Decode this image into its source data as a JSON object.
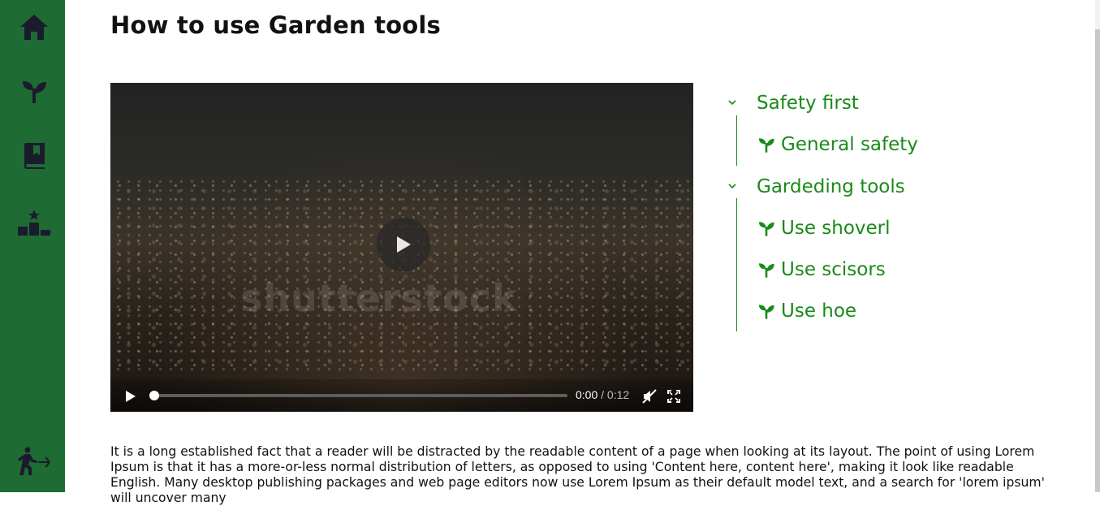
{
  "page": {
    "title": "How to use Garden tools"
  },
  "sidebar": {
    "items": [
      {
        "icon": "home-icon"
      },
      {
        "icon": "sprout-icon"
      },
      {
        "icon": "book-icon"
      },
      {
        "icon": "podium-icon"
      },
      {
        "icon": "exit-icon"
      }
    ]
  },
  "video": {
    "watermark": "shutterstock",
    "current_time": "0:00",
    "separator": " / ",
    "duration": "0:12",
    "progress": 0.0,
    "muted": true
  },
  "toc": {
    "sections": [
      {
        "label": "Safety first",
        "expanded": true,
        "items": [
          {
            "label": "General safety"
          }
        ]
      },
      {
        "label": "Gardeding tools",
        "expanded": true,
        "items": [
          {
            "label": "Use shoverl"
          },
          {
            "label": "Use scisors"
          },
          {
            "label": "Use hoe"
          }
        ]
      }
    ]
  },
  "content": {
    "paragraph": "It is a long established fact that a reader will be distracted by the readable content of a page when looking at its layout. The point of using Lorem Ipsum is that it has a more-or-less normal distribution of letters, as opposed to using 'Content here, content here', making it look like readable English. Many desktop publishing packages and web page editors now use Lorem Ipsum as their default model text, and a search for 'lorem ipsum' will uncover many"
  },
  "colors": {
    "sidebar": "#1e6b34",
    "accent": "#1a8a1a",
    "icon": "#1b1b2e"
  }
}
